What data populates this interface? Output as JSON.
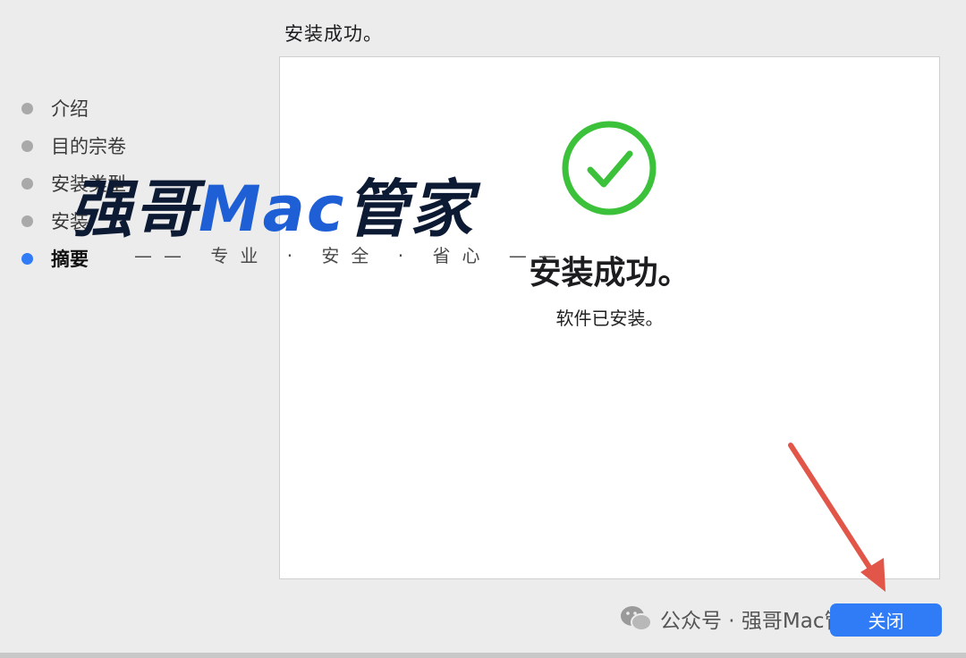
{
  "window": {
    "heading": "安装成功。"
  },
  "sidebar": {
    "steps": [
      {
        "label": "介绍",
        "active": false
      },
      {
        "label": "目的宗卷",
        "active": false
      },
      {
        "label": "安装类型",
        "active": false
      },
      {
        "label": "安装",
        "active": false
      },
      {
        "label": "摘要",
        "active": true
      }
    ]
  },
  "panel": {
    "icon": "checkmark-circle-icon",
    "title": "安装成功。",
    "subtitle": "软件已安装。"
  },
  "watermark": {
    "brand_prefix": "强哥",
    "brand_mac": "Mac",
    "brand_suffix": "管家",
    "tagline": "—— 专业 · 安全 · 省心 ——",
    "footer_text": "公众号 · 强哥Mac管家",
    "footer_icon": "wechat-icon"
  },
  "buttons": {
    "close_label": "关闭"
  },
  "colors": {
    "accent": "#2f7cf6",
    "success_green": "#3cc13b",
    "arrow_red": "#e2564a"
  }
}
